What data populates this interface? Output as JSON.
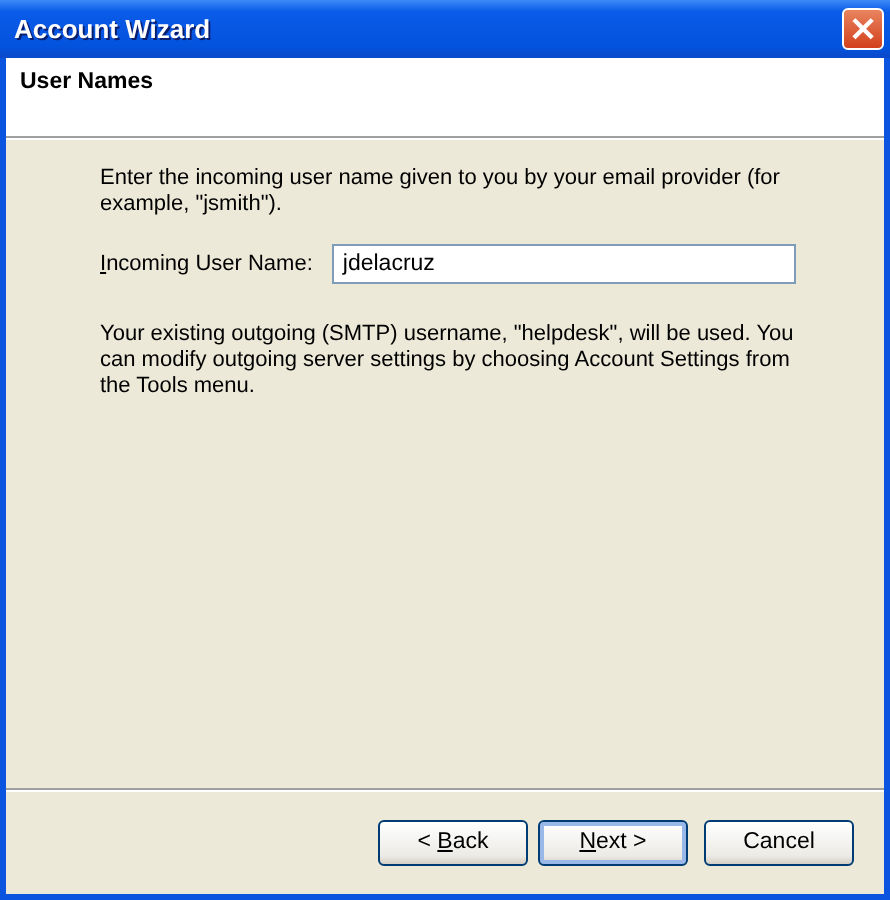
{
  "window": {
    "title": "Account Wizard",
    "close_icon": "×"
  },
  "header": {
    "title": "User Names"
  },
  "intro": "Enter the incoming user name given to you by your email provider (for example, \"jsmith\").",
  "field": {
    "label": [
      {
        "text": "I",
        "underlined": true
      },
      {
        "text": "ncoming User Name:",
        "underlined": false
      }
    ],
    "value": "jdelacruz"
  },
  "note": "Your existing outgoing (SMTP) username, \"helpdesk\", will be used. You can modify outgoing server settings by choosing Account Settings from the Tools menu.",
  "buttons": [
    {
      "label": [
        {
          "text": "< ",
          "underlined": false
        },
        {
          "text": "B",
          "underlined": true
        },
        {
          "text": "ack",
          "underlined": false
        }
      ],
      "default": false
    },
    {
      "label": [
        {
          "text": "N",
          "underlined": true
        },
        {
          "text": "ext >",
          "underlined": false
        }
      ],
      "default": true
    },
    {
      "label": [
        {
          "text": "Cancel",
          "underlined": false
        }
      ],
      "default": false
    }
  ]
}
